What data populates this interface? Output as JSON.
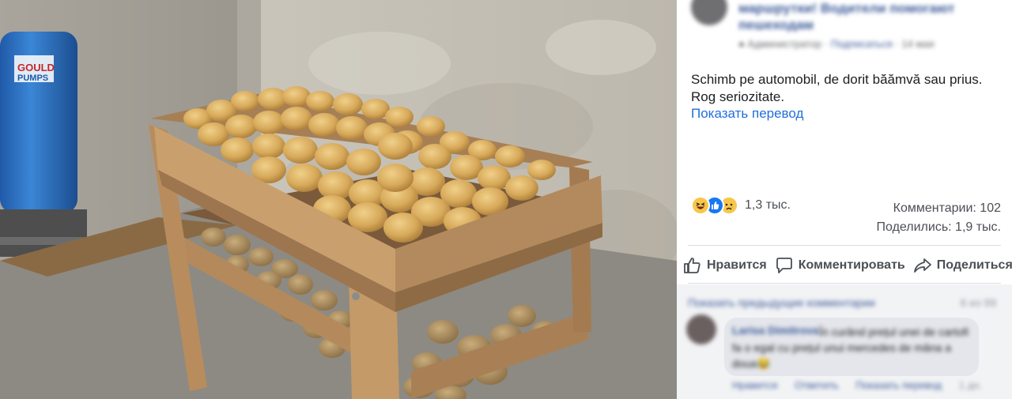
{
  "post": {
    "group_name": "маршрутки! Водители помогают пешеходам",
    "meta_role": "Администратор",
    "meta_link": "Подписаться",
    "meta_time": "14 мая",
    "text_line1": "Schimb pe automobil, de dorit bă̆ămvă sau prius.",
    "text_line2": "Rog seriozitate.",
    "translate_link": "Показать перевод"
  },
  "reactions": {
    "icons": [
      "haha-icon",
      "like-icon",
      "sad-icon"
    ],
    "count": "1,3 тыс."
  },
  "stats": {
    "comments": "Комментарии: 102",
    "shares": "Поделились: 1,9 тыс."
  },
  "actions": {
    "like": "Нравится",
    "comment": "Комментировать",
    "share": "Поделиться"
  },
  "comments": {
    "prev_link": "Показать предыдущие комментарии",
    "prev_count": "6 из 99",
    "first": {
      "author": "Larisa Dimitrova",
      "text": "În curând prețul unei de cartofi fa o egal cu prețul unui mercedes de mâna a doua😂",
      "reply_like": "Нравится",
      "reply_answer": "Ответить",
      "reply_translate": "Показать перевод",
      "time": "1 дн."
    }
  },
  "colors": {
    "link": "#3b5998",
    "translate": "#216fdb",
    "text": "#1c1e21",
    "muted": "#4b4f56"
  }
}
